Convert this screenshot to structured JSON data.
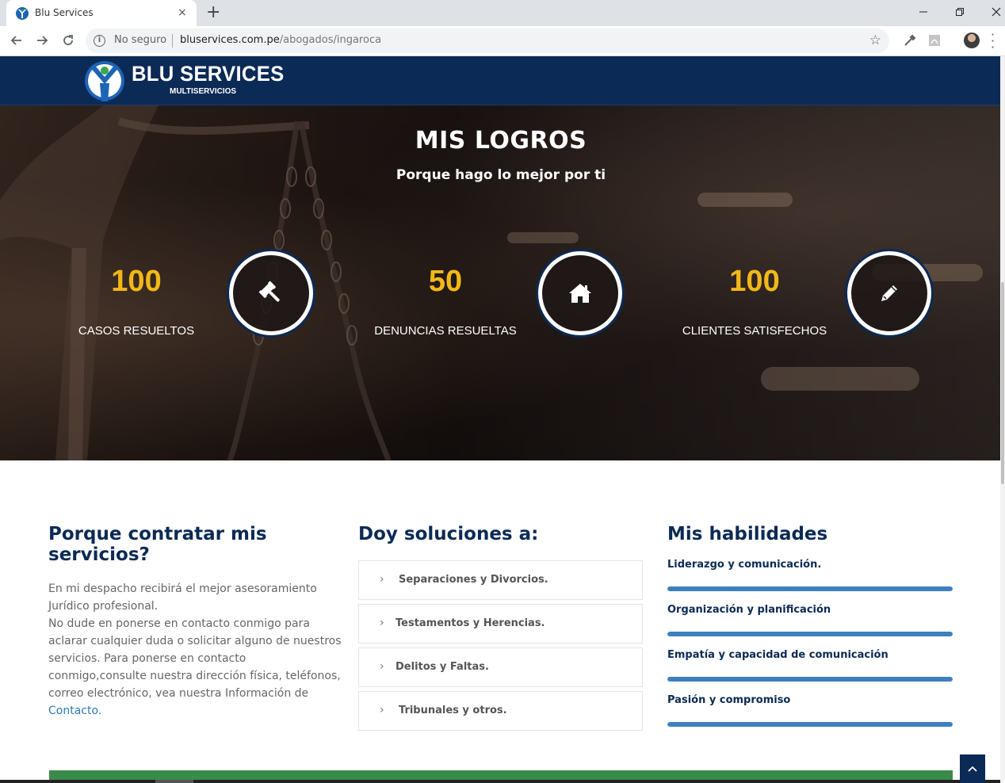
{
  "browser": {
    "tab_title": "Blu Services",
    "tab_close": "×",
    "new_tab": "+",
    "security_label": "No seguro",
    "url_domain": "bluservices.com.pe",
    "url_path": "/abogados/ingaroca"
  },
  "header": {
    "logo_name": "BLU SERVICES",
    "logo_subtitle": "MULTISERVICIOS",
    "brand_colors": {
      "navy": "#0b2a55",
      "green": "#3aa64a",
      "blue": "#1d64b4"
    }
  },
  "achievements": {
    "title": "MIS LOGROS",
    "subtitle": "Porque hago lo mejor por ti",
    "stats": [
      {
        "number": "100",
        "label": "CASOS RESUELTOS",
        "icon": "gavel-icon"
      },
      {
        "number": "50",
        "label": "DENUNCIAS RESUELTAS",
        "icon": "home-icon"
      },
      {
        "number": "100",
        "label": "CLIENTES SATISFECHOS",
        "icon": "pencil-icon"
      }
    ],
    "number_color": "#f2b818"
  },
  "about": {
    "title": "Porque contratar mis servicios?",
    "paragraph_1": "En mi despacho recibirá el mejor asesoramiento Jurídico profesional.",
    "paragraph_2": "No dude en ponerse en contacto conmigo para aclarar cualquier duda o solicitar alguno de nuestros servicios. Para ponerse en contacto conmigo,consulte nuestra dirección física, teléfonos, correo electrónico, vea nuestra Información de",
    "contact_link": "Contacto."
  },
  "solutions": {
    "title": "Doy soluciones a:",
    "items": [
      "Separaciones y Divorcios.",
      "Testamentos y Herencias.",
      "Delitos y Faltas.",
      "Tribunales y otros."
    ]
  },
  "skills": {
    "title": "Mis habilidades",
    "items": [
      {
        "label": "Liderazgo y comunicación.",
        "level": 100
      },
      {
        "label": "Organización y planificación",
        "level": 100
      },
      {
        "label": "Empatía y capacidad de comunicación",
        "level": 100
      },
      {
        "label": "Pasión y compromiso",
        "level": 100
      }
    ],
    "bar_color": "#3f7fc0"
  }
}
